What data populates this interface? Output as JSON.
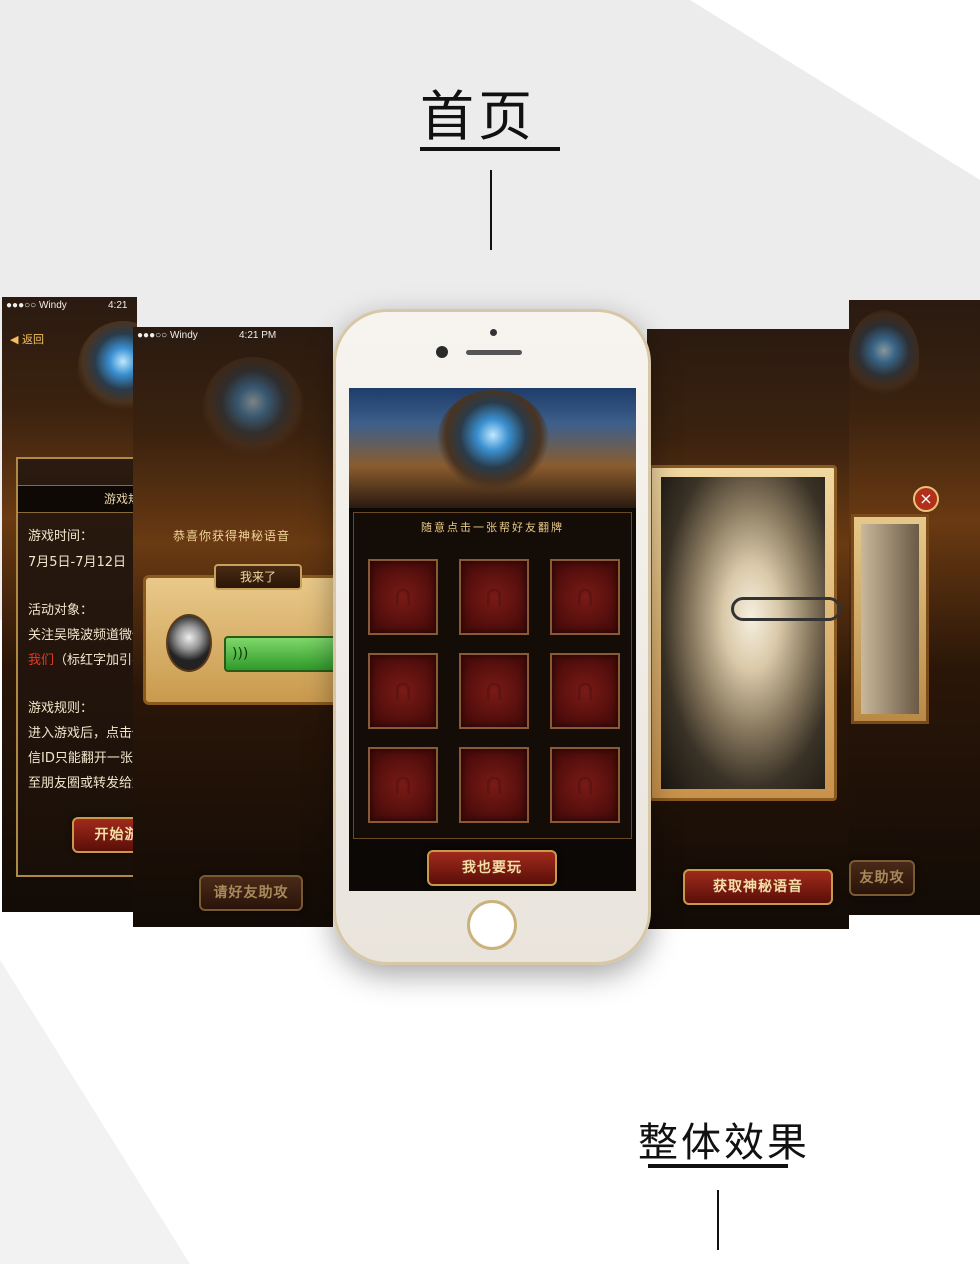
{
  "headings": {
    "home": "首页",
    "overall": "整体效果"
  },
  "left_screen_1": {
    "carrier": "●●●○○ Windy",
    "time": "4:21",
    "back": "返回",
    "panel_title": "游戏规",
    "lines": [
      "游戏时间：",
      "7月5日-7月12日",
      "活动对象：",
      "关注吴晓波频道微信公众",
      "（标红字加引导关注",
      "游戏规则：",
      "进入游戏后，点击任意一",
      "信ID只能翻开一张卡牌，",
      "至朋友圈或转发给好友邀"
    ],
    "red_word": "我们",
    "start_button": "开始游"
  },
  "left_screen_2": {
    "carrier": "●●●○○ Windy",
    "time": "4:21 PM",
    "congrats": "恭喜你获得神秘语音",
    "voice_tab": "我来了",
    "voice_icon": "sound-wave-icon",
    "help_button": "请好友助攻"
  },
  "phone_screen": {
    "board_title": "随意点击一张帮好友翻牌",
    "cards": [
      {
        "icon": "headphones-icon"
      },
      {
        "icon": "headphones-icon"
      },
      {
        "icon": "headphones-icon"
      },
      {
        "icon": "headphones-icon"
      },
      {
        "icon": "headphones-icon"
      },
      {
        "icon": "headphones-icon"
      },
      {
        "icon": "headphones-icon"
      },
      {
        "icon": "headphones-icon"
      },
      {
        "icon": "headphones-icon"
      }
    ],
    "play_button": "我也要玩"
  },
  "right_screen_1": {
    "secret_button": "获取神秘语音"
  },
  "right_screen_2": {
    "close": "×",
    "help_button": "友助攻"
  }
}
